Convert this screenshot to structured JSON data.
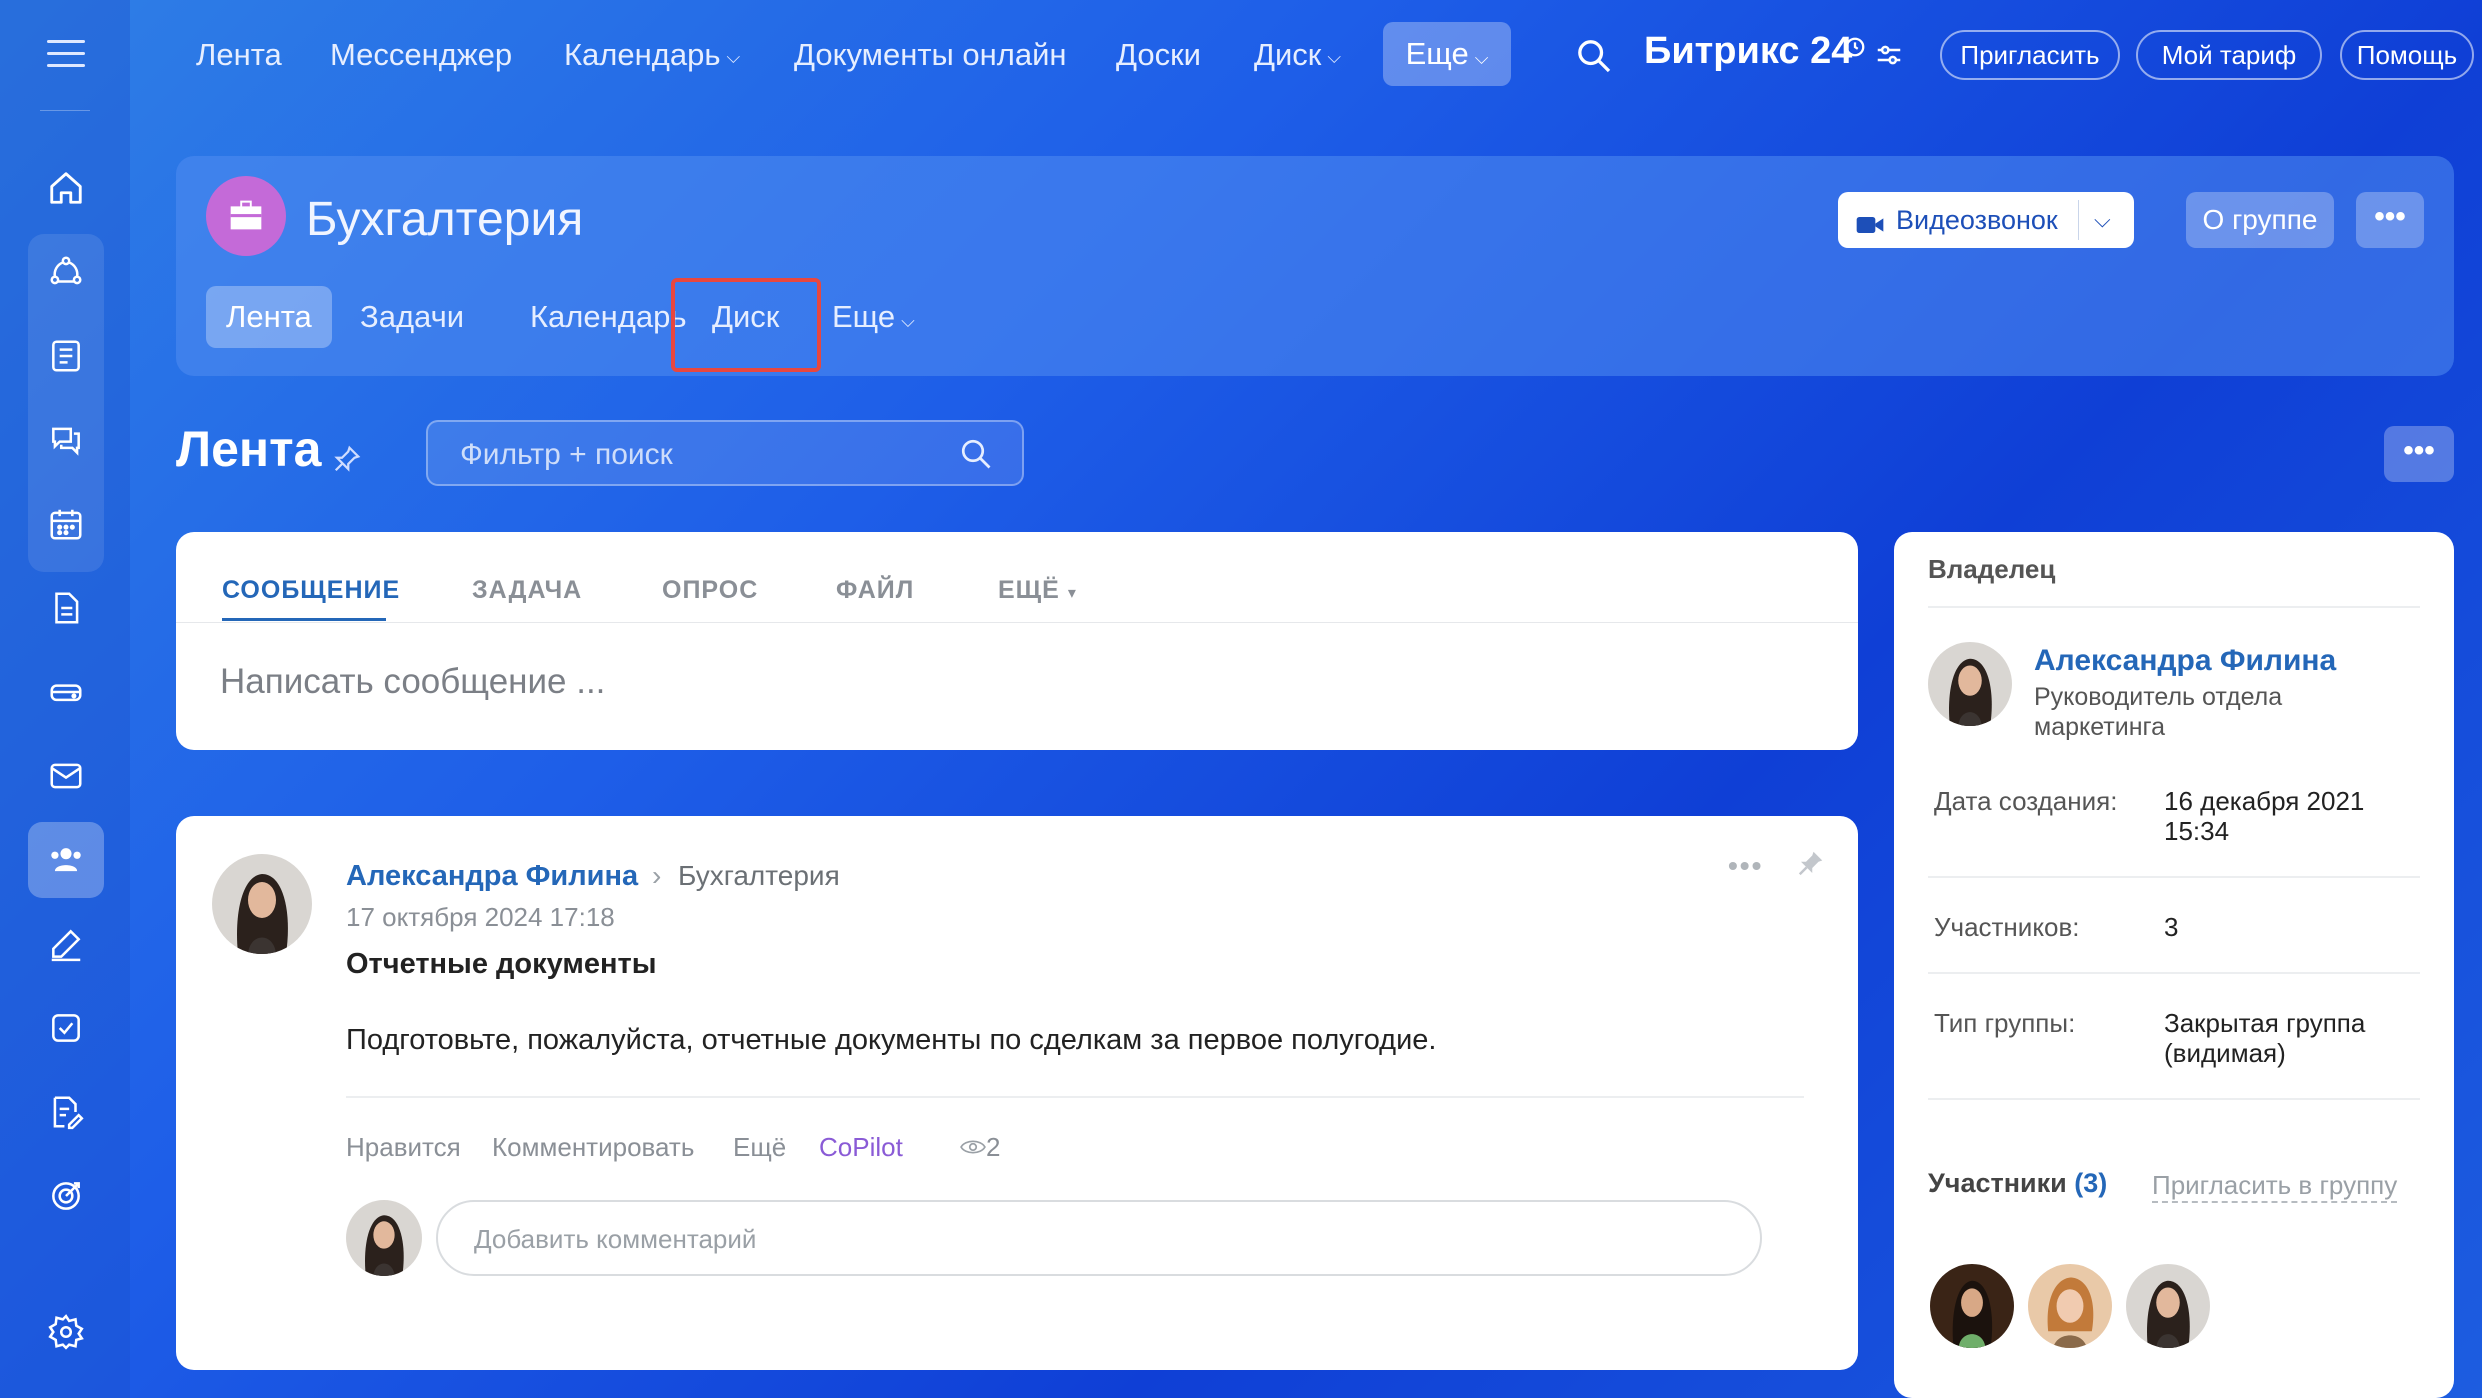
{
  "topnav": {
    "items": [
      "Лента",
      "Мессенджер",
      "Календарь",
      "Документы онлайн",
      "Доски",
      "Диск"
    ],
    "more": "Еще",
    "brand": "Битрикс 24",
    "invite": "Пригласить",
    "tariff": "Мой тариф",
    "help": "Помощь"
  },
  "group": {
    "title": "Бухгалтерия",
    "tabs": [
      "Лента",
      "Задачи",
      "Календарь",
      "Диск",
      "Еще"
    ],
    "video_call": "Видеозвонок",
    "about": "О группе",
    "dots": "•••"
  },
  "feed": {
    "title": "Лента",
    "search_placeholder": "Фильтр + поиск",
    "dots": "•••"
  },
  "composer": {
    "tabs": [
      "СООБЩЕНИЕ",
      "ЗАДАЧА",
      "ОПРОС",
      "ФАЙЛ",
      "ЕЩЁ"
    ],
    "placeholder": "Написать сообщение ..."
  },
  "post": {
    "author": "Александра Филина",
    "group": "Бухгалтерия",
    "date": "17 октября 2024 17:18",
    "title": "Отчетные документы",
    "body": "Подготовьте, пожалуйста, отчетные документы по сделкам за первое полугодие.",
    "actions": [
      "Нравится",
      "Комментировать",
      "Ещё",
      "CoPilot"
    ],
    "views": "2",
    "comment_placeholder": "Добавить комментарий",
    "dots": "•••"
  },
  "sidebar": {
    "owner_label": "Владелец",
    "owner_name": "Александра Филина",
    "owner_role": "Руководитель отдела маркетинга",
    "created_label": "Дата создания:",
    "created_value": "16 декабря 2021 15:34",
    "members_label": "Участников:",
    "members_value": "3",
    "type_label": "Тип группы:",
    "type_value": "Закрытая группа (видимая)",
    "members_title": "Участники",
    "members_count": "(3)",
    "invite_link": "Пригласить в группу"
  }
}
